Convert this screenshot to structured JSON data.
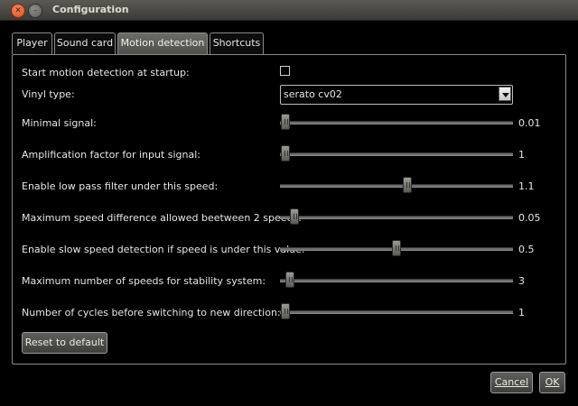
{
  "window": {
    "title": "Configuration"
  },
  "tabs": [
    {
      "label": "Player",
      "active": false
    },
    {
      "label": "Sound card",
      "active": false
    },
    {
      "label": "Motion detection",
      "active": true
    },
    {
      "label": "Shortcuts",
      "active": false
    }
  ],
  "settings": {
    "startup": {
      "label": "Start motion detection at startup:",
      "checked": false
    },
    "vinyl": {
      "label": "Vinyl type:",
      "value": "serato cv02"
    },
    "sliders": [
      {
        "label": "Minimal signal:",
        "value": "0.01",
        "position": 0.0
      },
      {
        "label": "Amplification factor for input signal:",
        "value": "1",
        "position": 0.0
      },
      {
        "label": "Enable low pass filter under this speed:",
        "value": "1.1",
        "position": 0.55
      },
      {
        "label": "Maximum speed difference allowed beetween 2 speeds:",
        "value": "0.05",
        "position": 0.04
      },
      {
        "label": "Enable slow speed detection if speed is under this value:",
        "value": "0.5",
        "position": 0.5
      },
      {
        "label": "Maximum number of speeds for stability system:",
        "value": "3",
        "position": 0.02
      },
      {
        "label": "Number of cycles before switching to new direction:",
        "value": "1",
        "position": 0.0
      }
    ]
  },
  "buttons": {
    "reset": "Reset to default",
    "cancel": "Cancel",
    "ok": "OK"
  },
  "colors": {
    "background": "#000000",
    "text": "#e6e6e6",
    "close_button": "#df4b16"
  }
}
